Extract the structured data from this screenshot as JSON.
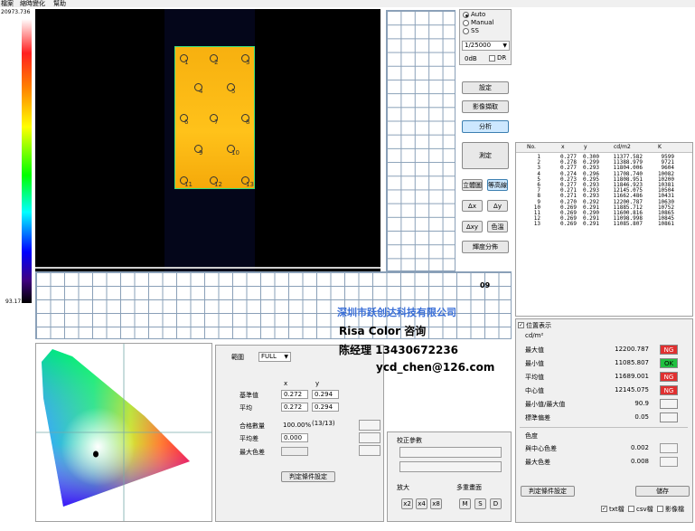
{
  "menu": [
    "檔案",
    "縮時變化",
    "幫助"
  ],
  "scale": {
    "max": "20973.736",
    "min": "93.171"
  },
  "image_points": [
    "1",
    "2",
    "3",
    "4",
    "5",
    "6",
    "7",
    "8",
    "9",
    "10",
    "11",
    "12",
    "13"
  ],
  "exposure": {
    "modes": [
      "Auto",
      "Manual",
      "SS"
    ],
    "selected": "Auto",
    "shutter": "1/25000",
    "gain": "0dB",
    "dr_label": "DR"
  },
  "buttons": {
    "settings": "設定",
    "capture": "影像擷取",
    "analyze": "分析",
    "measure": "測定",
    "view3d": "立體圖",
    "contour": "等高線",
    "dx": "Δx",
    "dy": "Δy",
    "dxy": "Δxy",
    "color": "色溫",
    "distribution": "輝度分佈",
    "judge_left": "判定條件設定",
    "judge_right": "判定條件設定",
    "save": "儲存",
    "x2": "x2",
    "x4": "x4",
    "x8": "x8",
    "m": "M",
    "s": "S",
    "d": "D"
  },
  "label_09": "09",
  "table": {
    "headers": [
      "No.",
      "x",
      "y",
      "cd/m2",
      "K"
    ],
    "rows": [
      [
        "1",
        "0.277",
        "0.300",
        "11377.582",
        "9599"
      ],
      [
        "2",
        "0.278",
        "0.299",
        "11388.979",
        "9721"
      ],
      [
        "3",
        "0.277",
        "0.293",
        "11804.006",
        "9604"
      ],
      [
        "4",
        "0.274",
        "0.296",
        "11708.740",
        "10082"
      ],
      [
        "5",
        "0.273",
        "0.295",
        "11808.951",
        "10200"
      ],
      [
        "6",
        "0.277",
        "0.293",
        "11846.923",
        "10381"
      ],
      [
        "7",
        "0.271",
        "0.293",
        "12145.075",
        "10504"
      ],
      [
        "8",
        "0.271",
        "0.293",
        "11662.486",
        "10431"
      ],
      [
        "9",
        "0.270",
        "0.292",
        "12200.787",
        "10630"
      ],
      [
        "10",
        "0.269",
        "0.291",
        "11885.712",
        "10752"
      ],
      [
        "11",
        "0.269",
        "0.290",
        "11600.816",
        "10865"
      ],
      [
        "12",
        "0.269",
        "0.291",
        "11098.998",
        "10845"
      ],
      [
        "13",
        "0.269",
        "0.291",
        "11085.807",
        "10861"
      ]
    ]
  },
  "position_display": "位置表示",
  "stats": {
    "unit": "cd/m²",
    "items": [
      {
        "label": "最大值",
        "value": "12200.787",
        "status": "NG",
        "color": "#e03030"
      },
      {
        "label": "最小值",
        "value": "11085.807",
        "status": "OK",
        "color": "#20c040"
      },
      {
        "label": "平均值",
        "value": "11689.001",
        "status": "NG",
        "color": "#e03030"
      },
      {
        "label": "中心值",
        "value": "12145.075",
        "status": "NG",
        "color": "#e03030"
      },
      {
        "label": "最小值/最大值",
        "value": "90.9",
        "status": "",
        "color": "#f4f4f4"
      },
      {
        "label": "標準偏差",
        "value": "0.05",
        "status": "",
        "color": "#f4f4f4"
      }
    ],
    "color_title": "色度",
    "color_items": [
      {
        "label": "與中心色差",
        "value": "0.002"
      },
      {
        "label": "最大色差",
        "value": "0.008"
      }
    ]
  },
  "export": {
    "txt": "txt檔",
    "csv": "csv檔",
    "image": "影像檔"
  },
  "range": {
    "label": "範圍",
    "value": "FULL",
    "col_x": "x",
    "col_y": "y",
    "ref_label": "基準值",
    "ref_x": "0.272",
    "ref_y": "0.294",
    "avg_label": "平均",
    "avg_x": "0.272",
    "avg_y": "0.294",
    "pass_label": "合格數量",
    "pass_value": "100.00%",
    "pass_count": "(13/13)",
    "avgdiff_label": "平均差",
    "avgdiff_value": "0.000",
    "maxdiff_label": "最大色差"
  },
  "correction": {
    "title": "校正參數",
    "zoom": "放大",
    "multi": "多重畫面"
  },
  "watermark": {
    "company": "深圳市跃创达科技有限公司",
    "line2": "Risa Color 咨询",
    "line3": "陈经理  13430672236",
    "email": "ycd_chen@126.com"
  }
}
